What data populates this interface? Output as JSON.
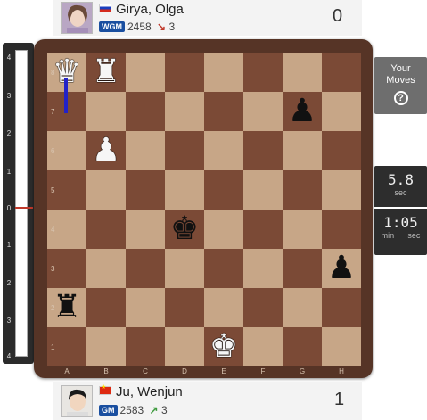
{
  "top_player": {
    "name": "Girya, Olga",
    "flag": "ru-flag-icon",
    "title": "WGM",
    "rating": "2458",
    "change_arrow": "↘",
    "change": "3",
    "score": "0"
  },
  "bottom_player": {
    "name": "Ju, Wenjun",
    "flag": "cn-flag-icon",
    "title": "GM",
    "rating": "2583",
    "change_arrow": "↗",
    "change": "3",
    "score": "1"
  },
  "eval_bar": {
    "labels_top": [
      "4",
      "3",
      "2",
      "1"
    ],
    "zero": "0",
    "labels_bottom": [
      "1",
      "2",
      "3",
      "4"
    ],
    "value": 0
  },
  "board": {
    "files": [
      "A",
      "B",
      "C",
      "D",
      "E",
      "F",
      "G",
      "H"
    ],
    "ranks": [
      "8",
      "7",
      "6",
      "5",
      "4",
      "3",
      "2",
      "1"
    ],
    "pieces": [
      {
        "square": "a8",
        "piece": "white-queen",
        "glyph": "♛",
        "color": "white"
      },
      {
        "square": "b8",
        "piece": "white-rook",
        "glyph": "♜",
        "color": "white"
      },
      {
        "square": "g7",
        "piece": "black-pawn",
        "glyph": "♟",
        "color": "black"
      },
      {
        "square": "b6",
        "piece": "white-pawn",
        "glyph": "♟",
        "color": "white"
      },
      {
        "square": "d4",
        "piece": "black-king",
        "glyph": "♚",
        "color": "black"
      },
      {
        "square": "h3",
        "piece": "black-pawn",
        "glyph": "♟",
        "color": "black"
      },
      {
        "square": "a2",
        "piece": "black-rook",
        "glyph": "♜",
        "color": "black"
      },
      {
        "square": "e1",
        "piece": "white-king",
        "glyph": "♚",
        "color": "white"
      }
    ],
    "light_color": "#c7a687",
    "dark_color": "#7b4a36",
    "arrow_color": "#2222c8"
  },
  "your_moves": {
    "label_line1": "Your",
    "label_line2": "Moves",
    "icon": "help-icon",
    "icon_glyph": "?"
  },
  "clock_top": {
    "value": "5.8",
    "unit": "sec"
  },
  "clock_bottom": {
    "value": "1:05",
    "unit_min": "min",
    "unit_sec": "sec"
  }
}
